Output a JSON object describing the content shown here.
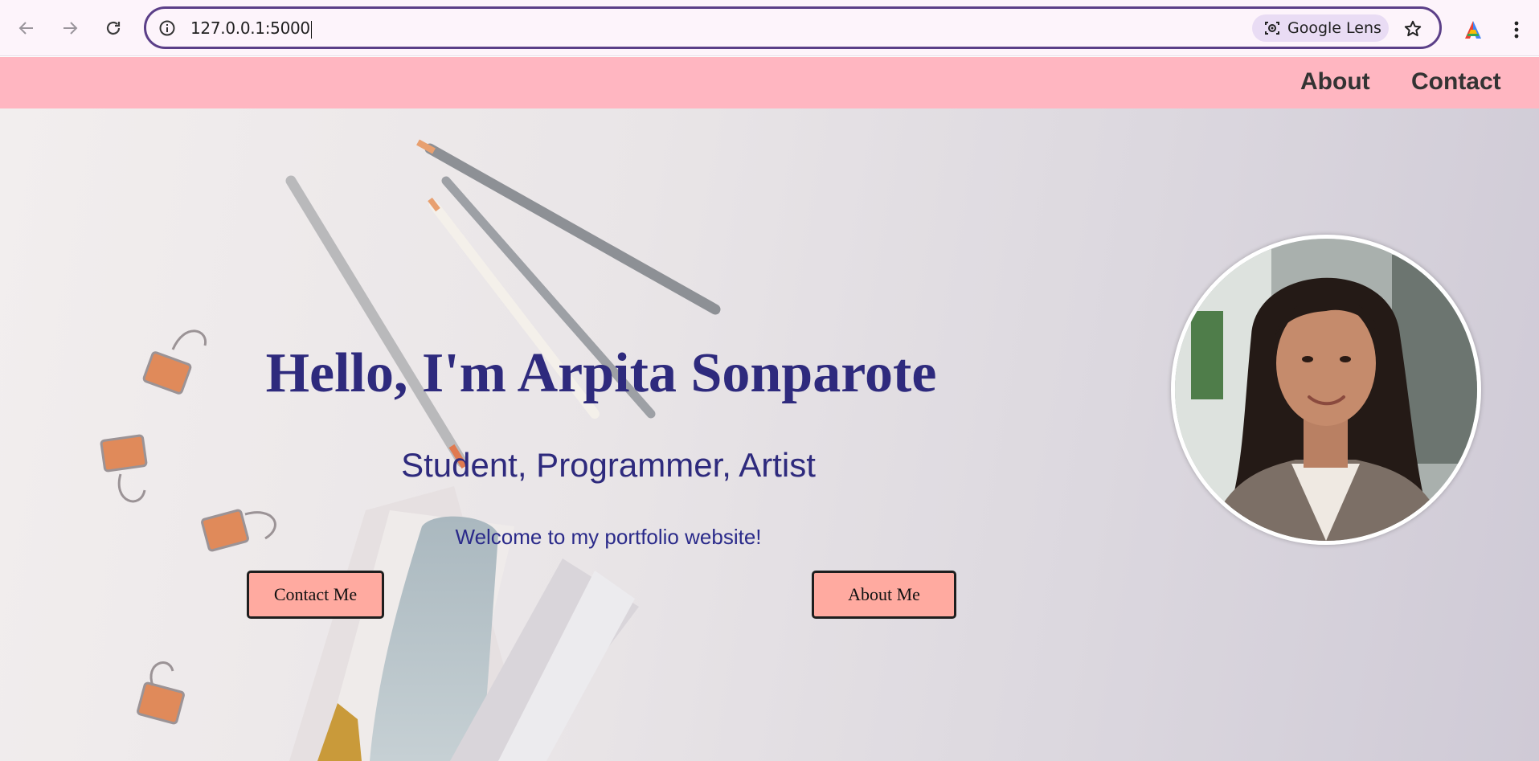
{
  "browser": {
    "url": "127.0.0.1:5000",
    "lens_label": "Google Lens",
    "accent_color": "#5b3f88"
  },
  "site_nav": {
    "background": "#ffb6c1",
    "links": [
      {
        "label": "About"
      },
      {
        "label": "Contact"
      }
    ]
  },
  "hero": {
    "title": "Hello, I'm Arpita Sonparote",
    "subtitle": "Student, Programmer, Artist",
    "welcome": "Welcome to my portfolio website!",
    "buttons": {
      "contact": "Contact Me",
      "about": "About Me"
    },
    "button_color": "#ffaaa0",
    "text_color": "#2e2a7d"
  },
  "icons": {
    "back": "back-arrow-icon",
    "forward": "forward-arrow-icon",
    "reload": "reload-icon",
    "site_info": "info-icon",
    "lens": "camera-lens-icon",
    "bookmark": "star-icon",
    "profile": "profile-icon",
    "menu": "kebab-menu-icon"
  }
}
